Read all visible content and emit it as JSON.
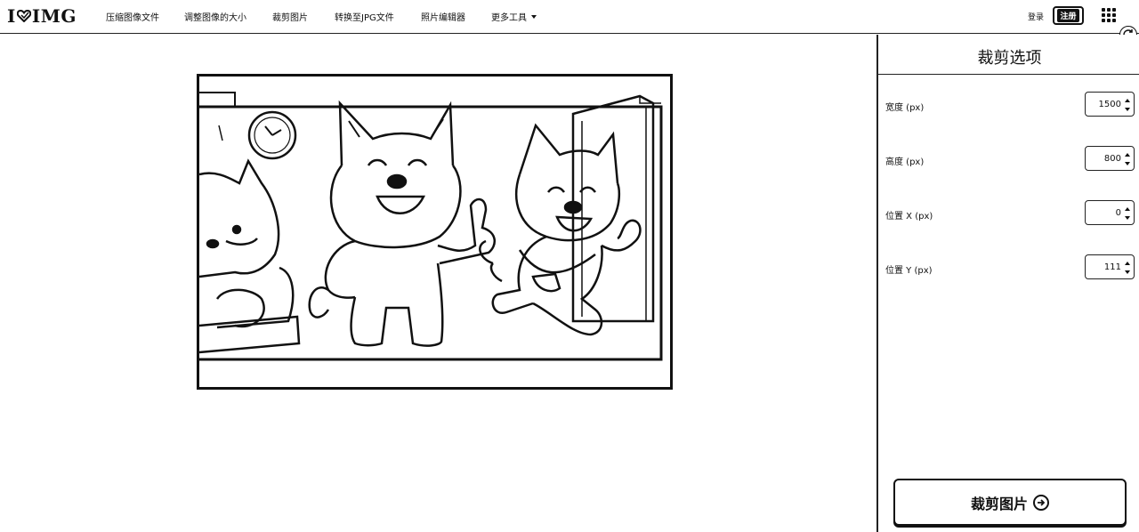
{
  "header": {
    "logo_left": "I",
    "logo_right": "IMG",
    "nav": [
      {
        "label": "压缩图像文件"
      },
      {
        "label": "调整图像的大小"
      },
      {
        "label": "裁剪图片"
      },
      {
        "label": "转换至JPG文件"
      },
      {
        "label": "照片编辑器"
      },
      {
        "label": "更多工具"
      }
    ],
    "login": "登录",
    "register": "注册"
  },
  "panel": {
    "title": "裁剪选项",
    "fields": [
      {
        "label": "宽度 (px)",
        "value": "1500"
      },
      {
        "label": "高度 (px)",
        "value": "800"
      },
      {
        "label": "位置 X (px)",
        "value": "0"
      },
      {
        "label": "位置 Y (px)",
        "value": "111"
      }
    ],
    "crop_button": "裁剪图片"
  },
  "colors": {
    "ink": "#111111",
    "background": "#ffffff"
  }
}
